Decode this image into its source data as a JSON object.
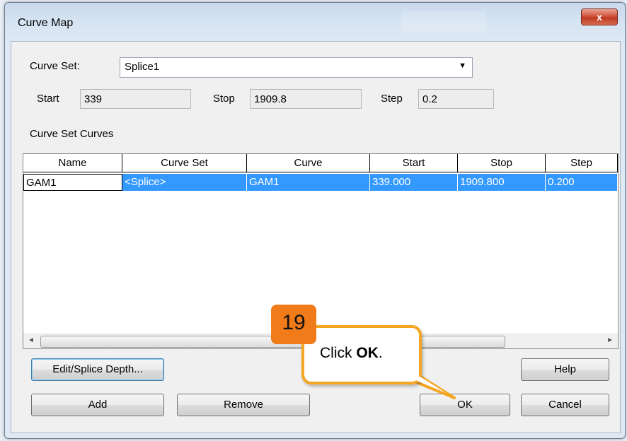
{
  "window": {
    "title": "Curve Map",
    "close_label": "x"
  },
  "curve_set": {
    "label": "Curve Set:",
    "value": "Splice1",
    "arrow": "▼"
  },
  "range": {
    "start_label": "Start",
    "start_value": "339",
    "stop_label": "Stop",
    "stop_value": "1909.8",
    "step_label": "Step",
    "step_value": "0.2"
  },
  "curves_section": {
    "label": "Curve Set Curves"
  },
  "table": {
    "headers": [
      "Name",
      "Curve Set",
      "Curve",
      "Start",
      "Stop",
      "Step"
    ],
    "rows": [
      [
        "GAM1",
        "<Splice>",
        "GAM1",
        "339.000",
        "1909.800",
        "0.200"
      ]
    ]
  },
  "scroll": {
    "left_arrow": "◄",
    "right_arrow": "►"
  },
  "buttons": {
    "edit_splice": "Edit/Splice Depth...",
    "help": "Help",
    "add": "Add",
    "remove": "Remove",
    "ok": "OK",
    "cancel": "Cancel"
  },
  "callout": {
    "step": "19",
    "text_prefix": "Click ",
    "text_bold": "OK",
    "text_suffix": ".",
    "color": "#f4a623",
    "badge_color": "#f07b18"
  }
}
